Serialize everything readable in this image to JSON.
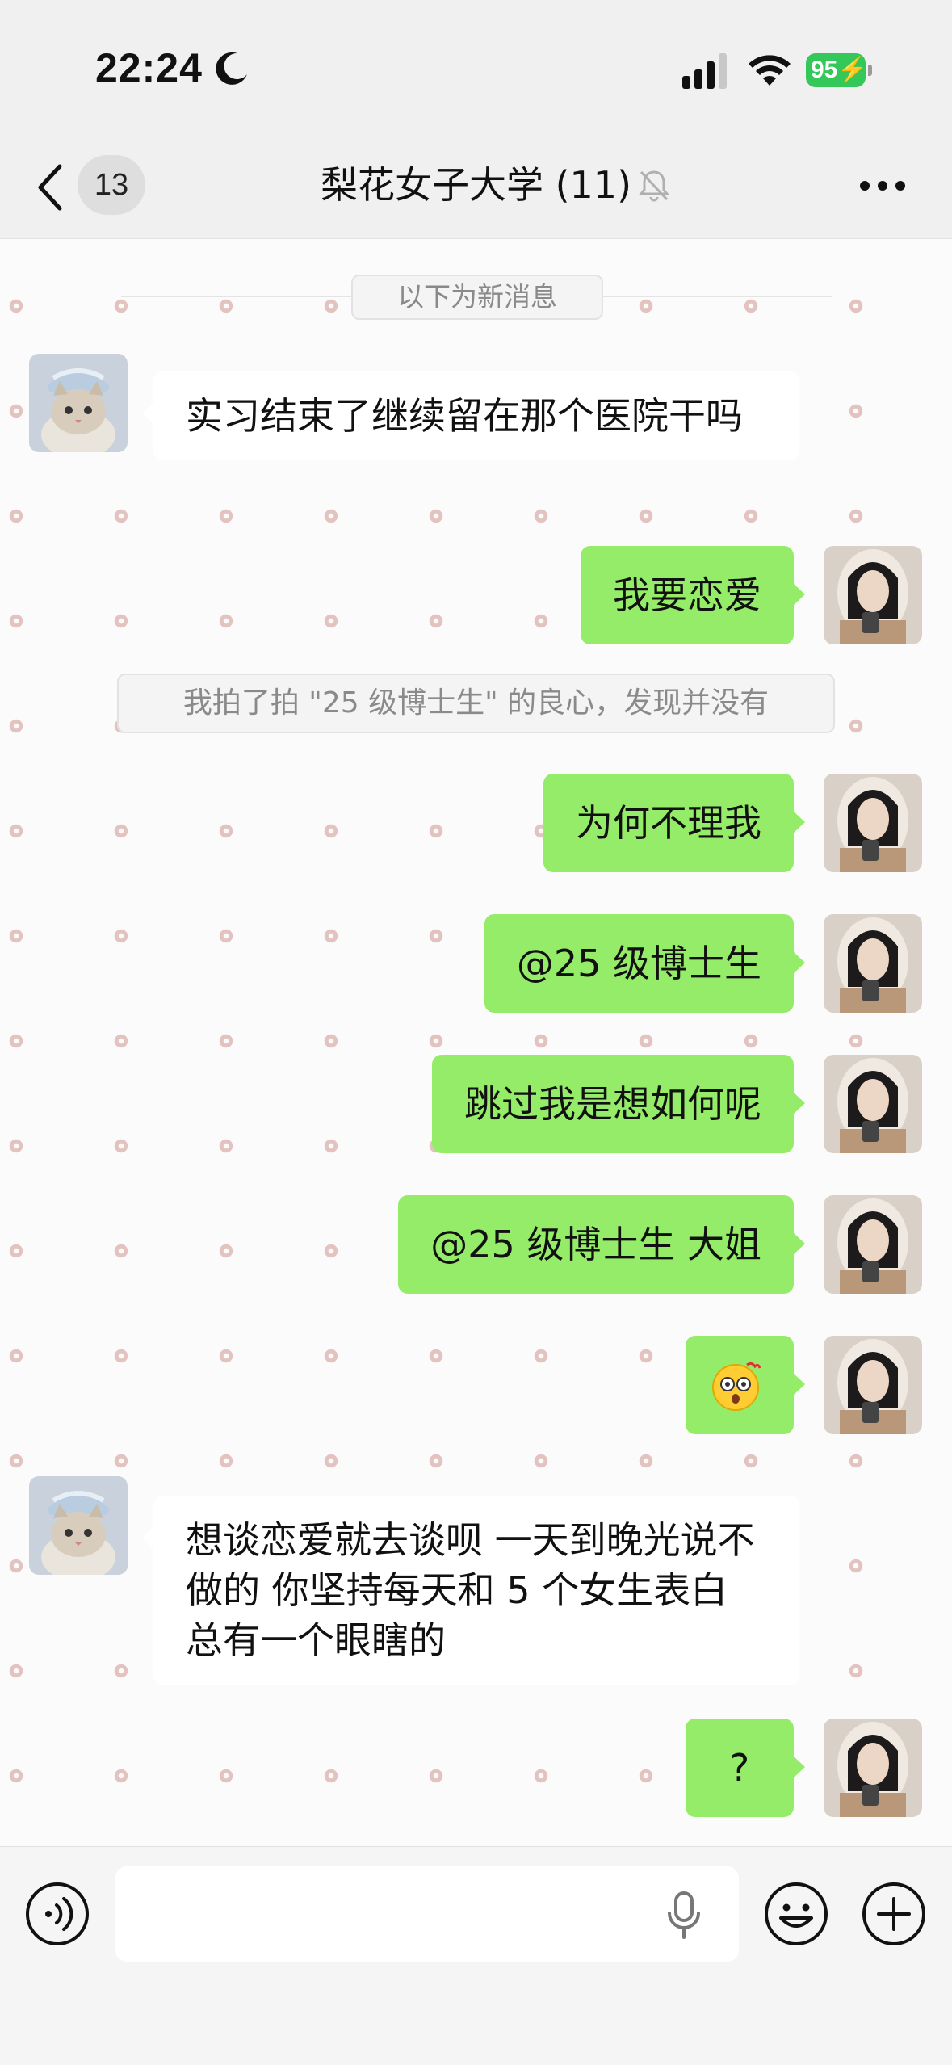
{
  "status_bar": {
    "time": "22:24",
    "battery_level": "95",
    "icons": [
      "moon-icon",
      "signal-icon",
      "wifi-icon",
      "battery-icon"
    ]
  },
  "nav": {
    "back_icon": "chevron-left-icon",
    "unread_count": "13",
    "title": "梨花女子大学 (11)",
    "mute_icon": "bell-muted-icon",
    "more_icon": "ellipsis-icon"
  },
  "chat": {
    "new_messages_divider": "以下为新消息",
    "system_notice": "我拍了拍 \"25 级博士生\" 的良心，发现并没有",
    "messages": [
      {
        "side": "left",
        "avatar": "cat-avatar",
        "text": "实习结束了继续留在那个医院干吗"
      },
      {
        "side": "right",
        "avatar": "user-avatar",
        "text": "我要恋爱"
      },
      {
        "side": "right",
        "avatar": "user-avatar",
        "text": "为何不理我"
      },
      {
        "side": "right",
        "avatar": "user-avatar",
        "text": "@25 级博士生"
      },
      {
        "side": "right",
        "avatar": "user-avatar",
        "text": "跳过我是想如何呢"
      },
      {
        "side": "right",
        "avatar": "user-avatar",
        "text": "@25 级博士生 大姐"
      },
      {
        "side": "right",
        "avatar": "user-avatar",
        "emoji": "flushed-face-emoji",
        "text": ""
      },
      {
        "side": "left",
        "avatar": "cat-avatar",
        "text": "想谈恋爱就去谈呗 一天到晚光说不做的 你坚持每天和 5 个女生表白 总有一个眼瞎的"
      },
      {
        "side": "right",
        "avatar": "user-avatar",
        "text": "?"
      }
    ]
  },
  "input_bar": {
    "placeholder": "",
    "icons": [
      "voice-icon",
      "microphone-icon",
      "emoji-icon",
      "plus-icon"
    ]
  },
  "colors": {
    "outgoing_bubble": "#95ec69",
    "incoming_bubble": "#ffffff",
    "battery": "#34c759",
    "background": "#fbfbfb"
  }
}
